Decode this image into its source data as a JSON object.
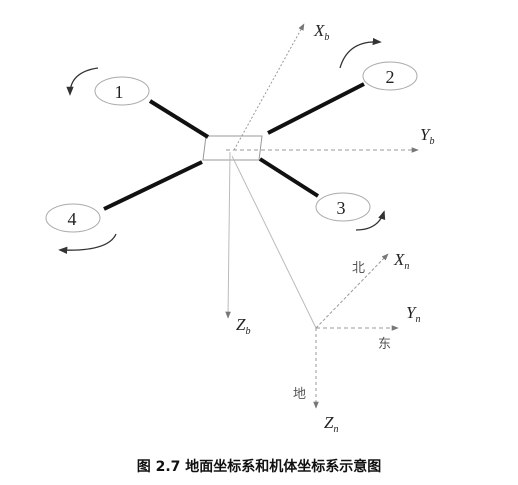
{
  "rotors": [
    {
      "label": "1"
    },
    {
      "label": "2"
    },
    {
      "label": "3"
    },
    {
      "label": "4"
    }
  ],
  "body_axes": {
    "x": {
      "main": "X",
      "sub": "b"
    },
    "y": {
      "main": "Y",
      "sub": "b"
    },
    "z": {
      "main": "Z",
      "sub": "b"
    }
  },
  "ground_axes": {
    "x": {
      "main": "X",
      "sub": "n",
      "direction": "北"
    },
    "y": {
      "main": "Y",
      "sub": "n",
      "direction": "东"
    },
    "z": {
      "main": "Z",
      "sub": "n",
      "direction": "地"
    }
  },
  "caption": "图 2.7  地面坐标系和机体坐标系示意图",
  "colors": {
    "arm": "#111111",
    "axis": "#888888",
    "text": "#222222"
  }
}
